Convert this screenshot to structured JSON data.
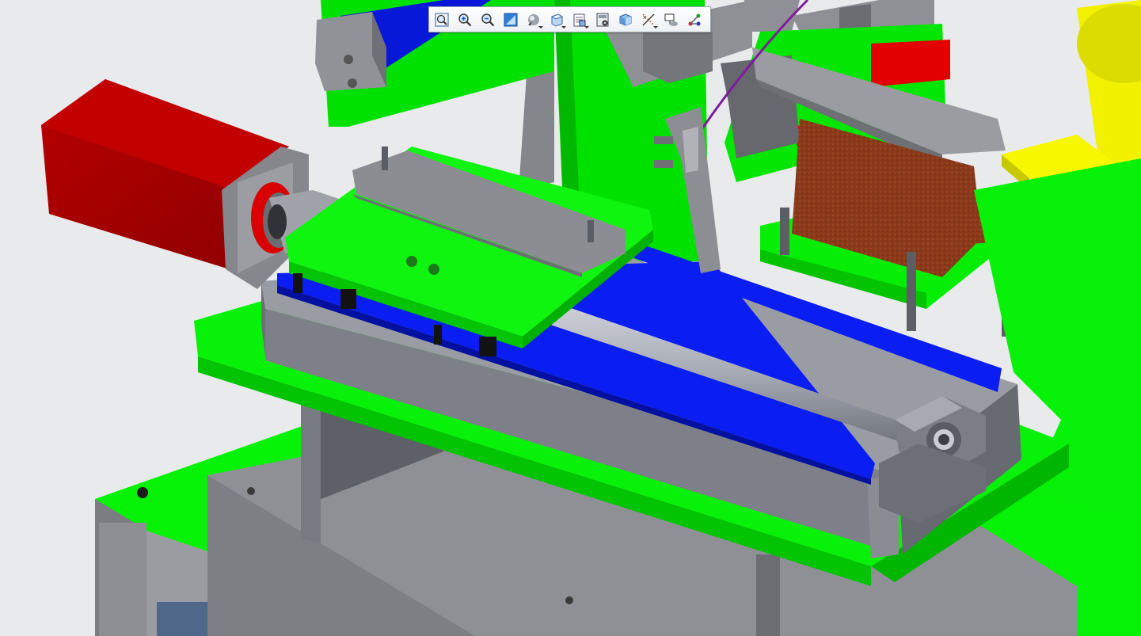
{
  "scene": {
    "colors": {
      "background": "#e9eaec",
      "base_plate": "#00f000",
      "frame_gray": "#8b8d92",
      "linear_rail": "#0a1cf0",
      "motor": "#a70000",
      "copper_part": "#8a3a1a",
      "feeder_bowl": "#f2f200"
    }
  },
  "toolbar": {
    "buttons": [
      {
        "name": "zoom-fit-icon",
        "has_menu": false
      },
      {
        "name": "zoom-in-icon",
        "has_menu": false
      },
      {
        "name": "zoom-out-icon",
        "has_menu": false
      },
      {
        "name": "repaint-icon",
        "has_menu": false
      },
      {
        "name": "display-style-icon",
        "has_menu": true
      },
      {
        "name": "saved-views-icon",
        "has_menu": true
      },
      {
        "name": "view-manager-icon",
        "has_menu": true
      },
      {
        "name": "appearance-icon",
        "has_menu": false
      },
      {
        "name": "perspective-icon",
        "has_menu": false
      },
      {
        "name": "datum-display-icon",
        "has_menu": true
      },
      {
        "name": "annotation-display-icon",
        "has_menu": false
      },
      {
        "name": "spin-center-icon",
        "has_menu": false
      }
    ]
  }
}
